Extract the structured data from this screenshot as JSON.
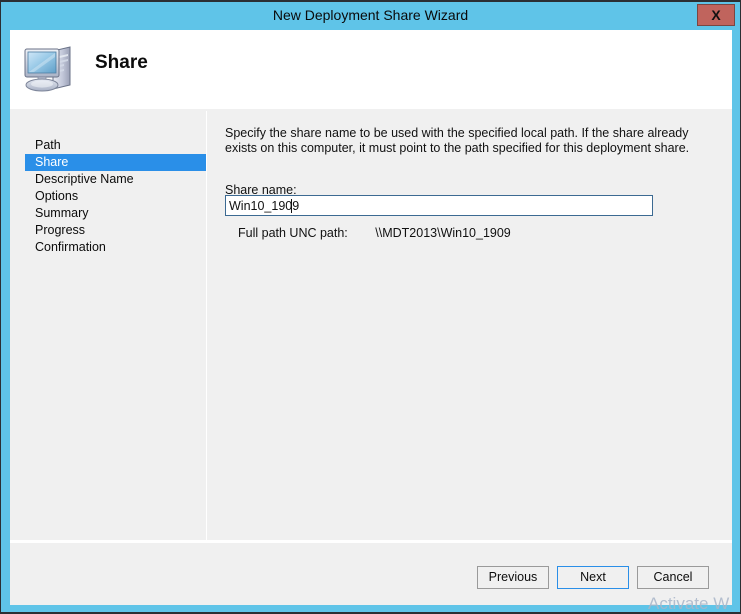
{
  "window": {
    "title": "New Deployment Share Wizard",
    "close_label": "X",
    "titlebar_color": "#5fc4e8",
    "close_button_color": "#c0645d"
  },
  "header": {
    "title": "Share",
    "icon": "computer-icon"
  },
  "sidebar": {
    "items": [
      {
        "label": "Path",
        "selected": false
      },
      {
        "label": "Share",
        "selected": true
      },
      {
        "label": "Descriptive Name",
        "selected": false
      },
      {
        "label": "Options",
        "selected": false
      },
      {
        "label": "Summary",
        "selected": false
      },
      {
        "label": "Progress",
        "selected": false
      },
      {
        "label": "Confirmation",
        "selected": false
      }
    ],
    "selection_color": "#2a8fe8"
  },
  "main": {
    "instructions": "Specify the share name to be used with the specified local path.  If the share already exists on this computer, it must point to the path specified for this deployment share.",
    "share_name_label": "Share name:",
    "share_name_value": "Win10_1909",
    "share_name_placeholder": "",
    "unc_label": "Full path UNC path:",
    "unc_value": "\\\\MDT2013\\Win10_1909"
  },
  "footer": {
    "previous_label": "Previous",
    "next_label": "Next",
    "cancel_label": "Cancel",
    "default_button": "Next"
  },
  "watermark": {
    "text": "Activate W"
  }
}
